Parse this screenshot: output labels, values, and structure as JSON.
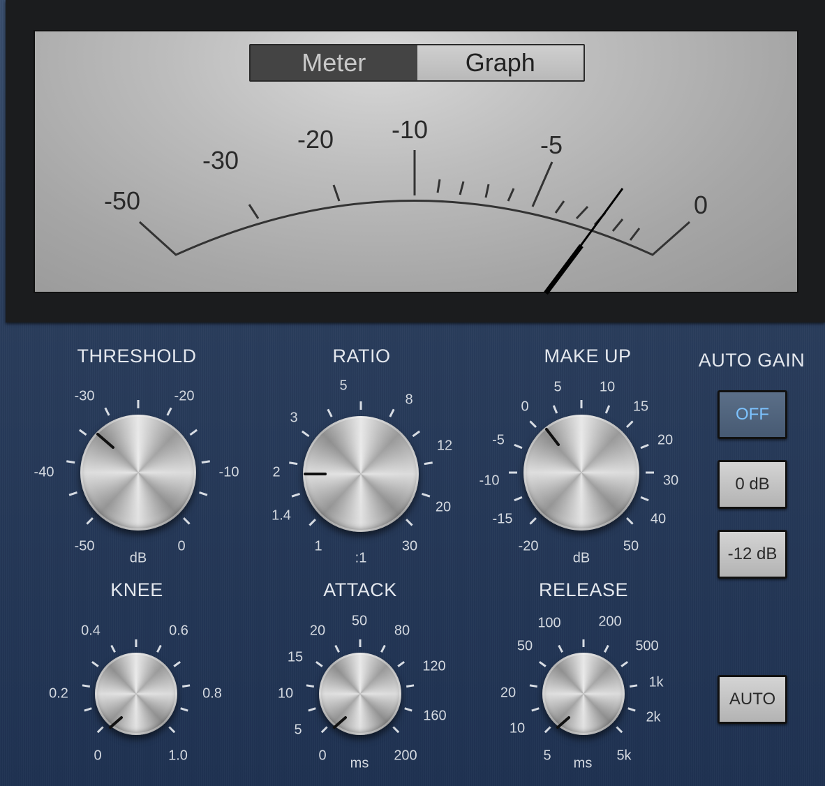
{
  "meter": {
    "tabs": [
      {
        "label": "Meter",
        "active": false
      },
      {
        "label": "Graph",
        "active": true
      }
    ],
    "scale_labels": [
      "-50",
      "-30",
      "-20",
      "-10",
      "-5",
      "0"
    ]
  },
  "controls": {
    "threshold": {
      "label": "THRESHOLD",
      "unit": "dB",
      "ticks": [
        "-30",
        "-20",
        "-40",
        "-10",
        "-50",
        "0"
      ]
    },
    "ratio": {
      "label": "RATIO",
      "unit": ":1",
      "ticks": [
        "5",
        "8",
        "3",
        "12",
        "2",
        "20",
        "1.4",
        "1",
        "30"
      ]
    },
    "makeup": {
      "label": "MAKE UP",
      "unit": "dB",
      "ticks": [
        "5",
        "10",
        "0",
        "15",
        "-5",
        "20",
        "-10",
        "30",
        "-15",
        "40",
        "-20",
        "50"
      ]
    },
    "knee": {
      "label": "KNEE",
      "unit": "",
      "ticks": [
        "0.4",
        "0.6",
        "0.2",
        "0.8",
        "0",
        "1.0"
      ]
    },
    "attack": {
      "label": "ATTACK",
      "unit": "ms",
      "ticks": [
        "50",
        "20",
        "80",
        "15",
        "120",
        "10",
        "5",
        "160",
        "0",
        "200"
      ]
    },
    "release": {
      "label": "RELEASE",
      "unit": "ms",
      "ticks": [
        "100",
        "200",
        "50",
        "500",
        "1k",
        "20",
        "2k",
        "10",
        "5",
        "5k"
      ]
    }
  },
  "auto_gain": {
    "label": "AUTO GAIN",
    "buttons": [
      {
        "label": "OFF",
        "selected": true
      },
      {
        "label": "0 dB",
        "selected": false
      },
      {
        "label": "-12 dB",
        "selected": false
      }
    ],
    "auto_label": "AUTO"
  },
  "colors": {
    "panel": "#2a3d5c",
    "selected_text": "#7dc3ff"
  }
}
